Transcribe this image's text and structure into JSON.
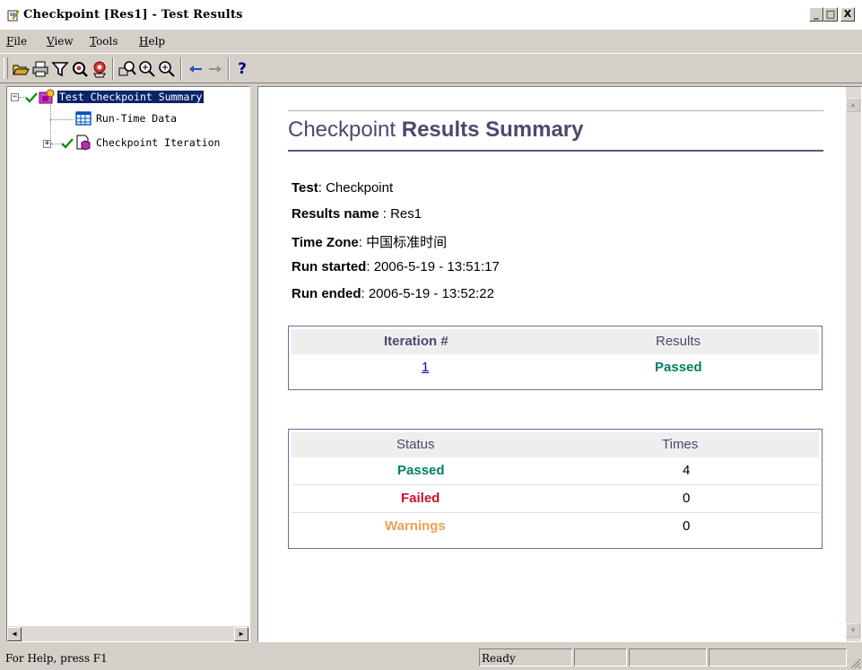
{
  "window": {
    "title": "Checkpoint [Res1] - Test Results",
    "minimize": "_",
    "maximize": "□",
    "close": "X"
  },
  "menu": {
    "items": [
      {
        "label": "File",
        "mnemonic": "F",
        "rest": "ile"
      },
      {
        "label": "View",
        "mnemonic": "V",
        "rest": "iew"
      },
      {
        "label": "Tools",
        "mnemonic": "T",
        "rest": "ools"
      },
      {
        "label": "Help",
        "mnemonic": "H",
        "rest": "elp"
      }
    ]
  },
  "toolbar": {
    "icons": [
      "open-icon",
      "print-icon",
      "filter-icon",
      "find-icon",
      "bitmap-checkpoint-icon",
      "zoom-fit-icon",
      "zoom-in-icon",
      "zoom-out-icon",
      "back-arrow-icon",
      "forward-arrow-icon",
      "help-icon"
    ],
    "help_glyph": "?"
  },
  "tree": {
    "items": [
      {
        "label": "Test Checkpoint Summary",
        "icon": "test-summary-icon",
        "status": "passed",
        "selected": true,
        "expanded": true
      },
      {
        "label": "Run-Time Data",
        "icon": "datatable-icon"
      },
      {
        "label": "Checkpoint Iteration",
        "icon": "iteration-icon",
        "status": "passed",
        "expanded": false
      }
    ],
    "expand_glyph": "+",
    "collapse_glyph": "−"
  },
  "report": {
    "title_light": "Checkpoint",
    "title_bold": "Results Summary",
    "info": [
      {
        "label": "Test",
        "sep": ": ",
        "value": "Checkpoint"
      },
      {
        "label": "Results name",
        "sep": " : ",
        "value": "Res1"
      },
      {
        "label": "Time Zone",
        "sep": ": ",
        "value": "中国标准时间"
      },
      {
        "label": "Run started",
        "sep": ": ",
        "value": "2006-5-19 - 13:51:17"
      },
      {
        "label": "Run ended",
        "sep": ": ",
        "value": "2006-5-19 - 13:52:22"
      }
    ],
    "iterations_table": {
      "headers": [
        "Iteration #",
        "Results"
      ],
      "rows": [
        {
          "iteration": "1",
          "result": "Passed"
        }
      ]
    },
    "status_table": {
      "headers": [
        "Status",
        "Times"
      ],
      "rows": [
        {
          "status": "Passed",
          "times": "4"
        },
        {
          "status": "Failed",
          "times": "0"
        },
        {
          "status": "Warnings",
          "times": "0"
        }
      ]
    }
  },
  "statusbar": {
    "help_text": "For Help, press F1",
    "state": "Ready"
  },
  "colors": {
    "passed": "#008060",
    "failed": "#d0102a",
    "warning": "#f0a050",
    "selection": "#0a246a",
    "title_text": "#4a4a6e"
  }
}
